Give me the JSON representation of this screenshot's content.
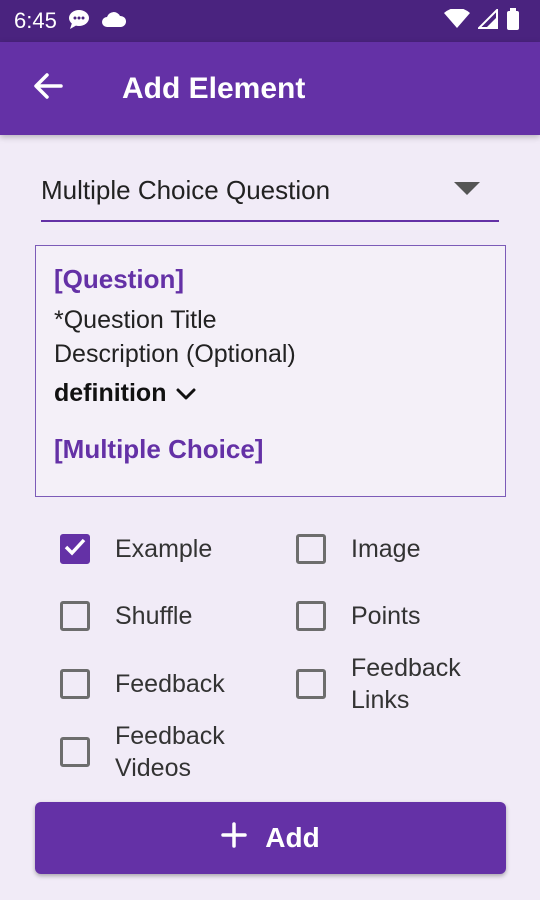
{
  "status_bar": {
    "time": "6:45",
    "icons": [
      "chat-bubble-icon",
      "cloud-icon",
      "wifi-icon",
      "signal-icon",
      "battery-icon"
    ]
  },
  "app_bar": {
    "title": "Add Element",
    "back_icon": "arrow-back-icon"
  },
  "element_type": {
    "value": "Multiple Choice Question",
    "icon": "dropdown-triangle-icon"
  },
  "preview": {
    "question_label": "[Question]",
    "question_title": "*Question Title",
    "description": "Description (Optional)",
    "definition_label": "definition",
    "choice_label": "[Multiple Choice]"
  },
  "options": [
    {
      "label": "Example",
      "checked": true
    },
    {
      "label": "Image",
      "checked": false
    },
    {
      "label": "Shuffle",
      "checked": false
    },
    {
      "label": "Points",
      "checked": false
    },
    {
      "label": "Feedback",
      "checked": false
    },
    {
      "label": "Feedback Links",
      "checked": false
    },
    {
      "label": "Feedback Videos",
      "checked": false
    }
  ],
  "add_button": {
    "label": "Add",
    "icon": "plus-icon"
  },
  "colors": {
    "primary": "#6431a6",
    "status_bar": "#4a237f",
    "background": "#f1ebf7"
  }
}
